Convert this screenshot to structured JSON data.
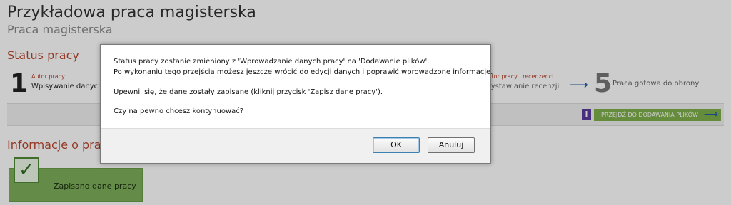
{
  "page": {
    "title": "Przykładowa praca magisterska",
    "subtitle": "Praca magisterska"
  },
  "status": {
    "heading": "Status pracy",
    "steps": [
      {
        "number": "1",
        "label": "Autor pracy",
        "name": "Wpisywanie danych"
      },
      {
        "label": "Autor pracy i recenzenci",
        "name": "Wystawianie recenzji"
      },
      {
        "number": "5",
        "name": "Praca gotowa do obrony"
      }
    ],
    "next_button": "PRZEJDŹ DO DODAWANIA PLIKÓW"
  },
  "info": {
    "heading": "Informacje o pracy",
    "saved_label": "Zapisano dane pracy"
  },
  "dialog": {
    "line1": "Status pracy zostanie zmieniony z 'Wprowadzanie danych pracy' na 'Dodawanie plików'.",
    "line2": "Po wykonaniu tego przejścia możesz jeszcze wrócić do edycji danych i poprawić wprowadzone informacje.",
    "line3": "Upewnij się, że dane zostały zapisane (kliknij przycisk 'Zapisz dane pracy').",
    "line4": "Czy na pewno chcesz kontynuować?",
    "ok_label": "OK",
    "cancel_label": "Anuluj"
  },
  "colors": {
    "accent": "#b9472e",
    "button_green": "#7fb04a",
    "overlay": "#000000"
  }
}
